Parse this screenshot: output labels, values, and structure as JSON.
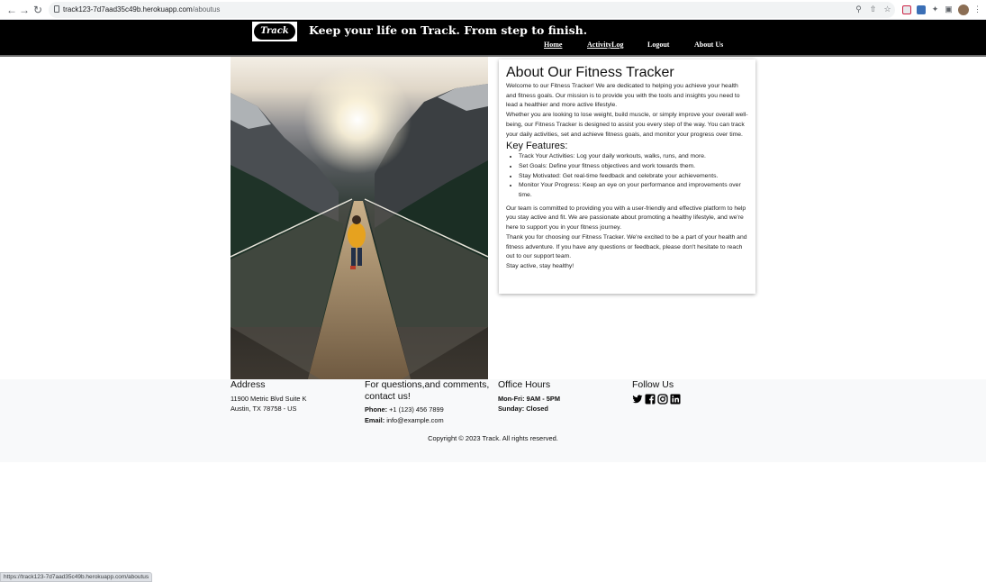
{
  "browser": {
    "url_host": "track123-7d7aad35c49b.herokuapp.com",
    "url_path": "/aboutus",
    "status_url": "https://track123-7d7aad35c49b.herokuapp.com/aboutus"
  },
  "header": {
    "logo_text": "Track",
    "tagline": "Keep your life on Track. From step to finish.",
    "nav": [
      {
        "label": "Home"
      },
      {
        "label": "ActivityLog"
      },
      {
        "label": "Logout"
      },
      {
        "label": "About Us"
      }
    ]
  },
  "about": {
    "title": "About Our Fitness Tracker",
    "intro_1": "Welcome to our Fitness Tracker! We are dedicated to helping you achieve your health and fitness goals. Our mission is to provide you with the tools and insights you need to lead a healthier and more active lifestyle.",
    "intro_2": "Whether you are looking to lose weight, build muscle, or simply improve your overall well-being, our Fitness Tracker is designed to assist you every step of the way. You can track your daily activities, set and achieve fitness goals, and monitor your progress over time.",
    "features_title": "Key Features:",
    "features": [
      "Track Your Activities: Log your daily workouts, walks, runs, and more.",
      "Set Goals: Define your fitness objectives and work towards them.",
      "Stay Motivated: Get real-time feedback and celebrate your achievements.",
      "Monitor Your Progress: Keep an eye on your performance and improvements over time."
    ],
    "outro_1": "Our team is committed to providing you with a user-friendly and effective platform to help you stay active and fit. We are passionate about promoting a healthy lifestyle, and we're here to support you in your fitness journey.",
    "outro_2": "Thank you for choosing our Fitness Tracker. We're excited to be a part of your health and fitness adventure. If you have any questions or feedback, please don't hesitate to reach out to our support team.",
    "outro_3": "Stay active, stay healthy!"
  },
  "footer": {
    "address": {
      "title": "Address",
      "line1": "11900 Metric Blvd Suite K",
      "line2": "Austin, TX 78758 - US"
    },
    "contact": {
      "title": "For questions,and comments, contact us!",
      "phone_label": "Phone:",
      "phone": "+1 (123) 456 7899",
      "email_label": "Email:",
      "email": "info@example.com"
    },
    "hours": {
      "title": "Office Hours",
      "weekday": "Mon-Fri: 9AM - 5PM",
      "sunday": "Sunday: Closed"
    },
    "follow": {
      "title": "Follow Us",
      "icons": [
        "twitter-icon",
        "facebook-icon",
        "instagram-icon",
        "linkedin-icon"
      ]
    },
    "copyright": "Copyright © 2023 Track. All rights reserved."
  }
}
